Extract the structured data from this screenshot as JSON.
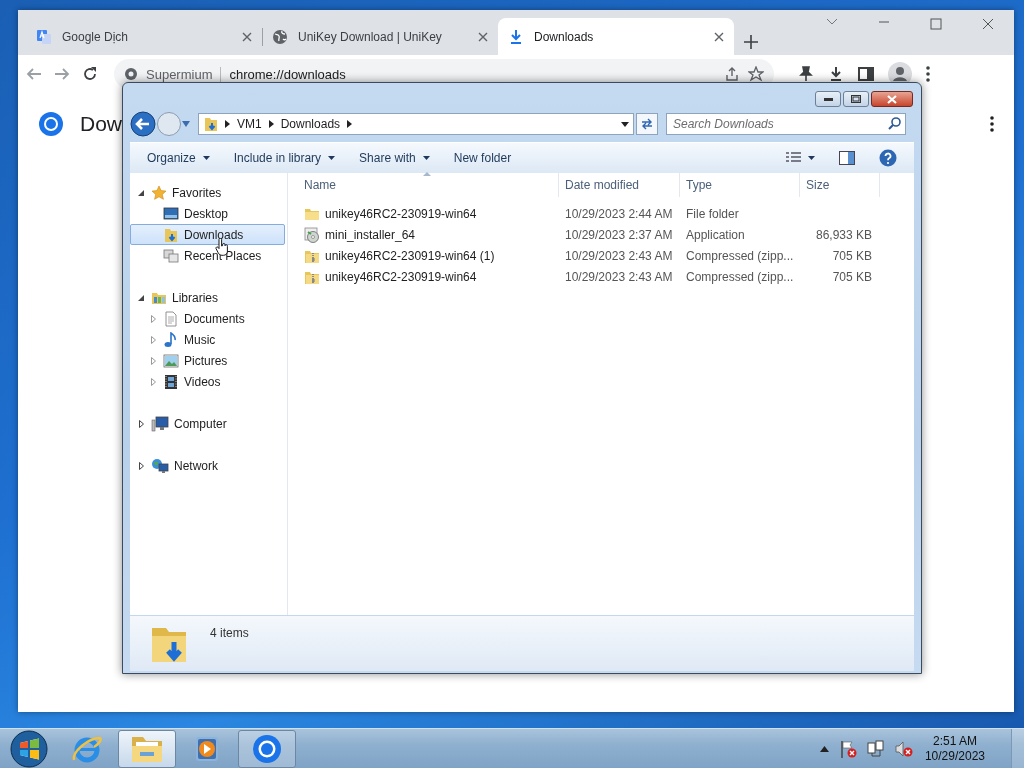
{
  "browser": {
    "tabs": [
      {
        "kind": "translate",
        "title": "Google Dịch",
        "selected": false
      },
      {
        "kind": "globe",
        "title": "UniKey Download | UniKey",
        "selected": false
      },
      {
        "kind": "download",
        "title": "Downloads",
        "selected": true
      }
    ],
    "address": {
      "site": "Supermium",
      "url": "chrome://downloads"
    },
    "page": {
      "title": "Dow"
    }
  },
  "explorer": {
    "breadcrumb": [
      "VM1",
      "Downloads"
    ],
    "search": {
      "placeholder": "Search Downloads"
    },
    "toolbar": [
      {
        "kind": "menu",
        "label": "Organize"
      },
      {
        "kind": "menu",
        "label": "Include in library"
      },
      {
        "kind": "menu",
        "label": "Share with"
      },
      {
        "kind": "button",
        "label": "New folder"
      }
    ],
    "nav": [
      {
        "kind": "star",
        "label": "Favorites",
        "expanded": true,
        "children": [
          {
            "kind": "desktop",
            "label": "Desktop",
            "selected": false
          },
          {
            "kind": "downloads",
            "label": "Downloads",
            "selected": true
          },
          {
            "kind": "recent",
            "label": "Recent Places",
            "selected": false
          }
        ]
      },
      {
        "kind": "library",
        "label": "Libraries",
        "expanded": true,
        "children": [
          {
            "kind": "document",
            "label": "Documents",
            "selected": false,
            "expanded": false
          },
          {
            "kind": "music",
            "label": "Music",
            "selected": false,
            "expanded": false
          },
          {
            "kind": "pictures",
            "label": "Pictures",
            "selected": false,
            "expanded": false
          },
          {
            "kind": "videos",
            "label": "Videos",
            "selected": false,
            "expanded": false
          }
        ]
      },
      {
        "kind": "computer",
        "label": "Computer",
        "expanded": false
      },
      {
        "kind": "network",
        "label": "Network",
        "expanded": false
      }
    ],
    "columns": [
      {
        "label": "Name",
        "sorted": true
      },
      {
        "label": "Date modified",
        "sorted": false
      },
      {
        "label": "Type",
        "sorted": false
      },
      {
        "label": "Size",
        "sorted": false
      }
    ],
    "rows": [
      {
        "kind": "folder",
        "name": "unikey46RC2-230919-win64",
        "date": "10/29/2023 2:44 AM",
        "type": "File folder"
      },
      {
        "kind": "app",
        "name": "mini_installer_64",
        "date": "10/29/2023 2:37 AM",
        "type": "Application",
        "size": "86,933 KB"
      },
      {
        "kind": "zip",
        "name": "unikey46RC2-230919-win64 (1)",
        "date": "10/29/2023 2:43 AM",
        "type": "Compressed (zipp...",
        "size": "705 KB"
      },
      {
        "kind": "zip",
        "name": "unikey46RC2-230919-win64",
        "date": "10/29/2023 2:43 AM",
        "type": "Compressed (zipp...",
        "size": "705 KB"
      }
    ],
    "status": {
      "count": "4 items"
    }
  },
  "taskbar": {
    "apps": [
      {
        "kind": "ie",
        "active": false,
        "running": false
      },
      {
        "kind": "explorer",
        "active": true,
        "running": true
      },
      {
        "kind": "media",
        "active": false,
        "running": false
      },
      {
        "kind": "chrome",
        "active": false,
        "running": true
      }
    ],
    "clock": {
      "time": "2:51 AM",
      "date": "10/29/2023"
    }
  }
}
